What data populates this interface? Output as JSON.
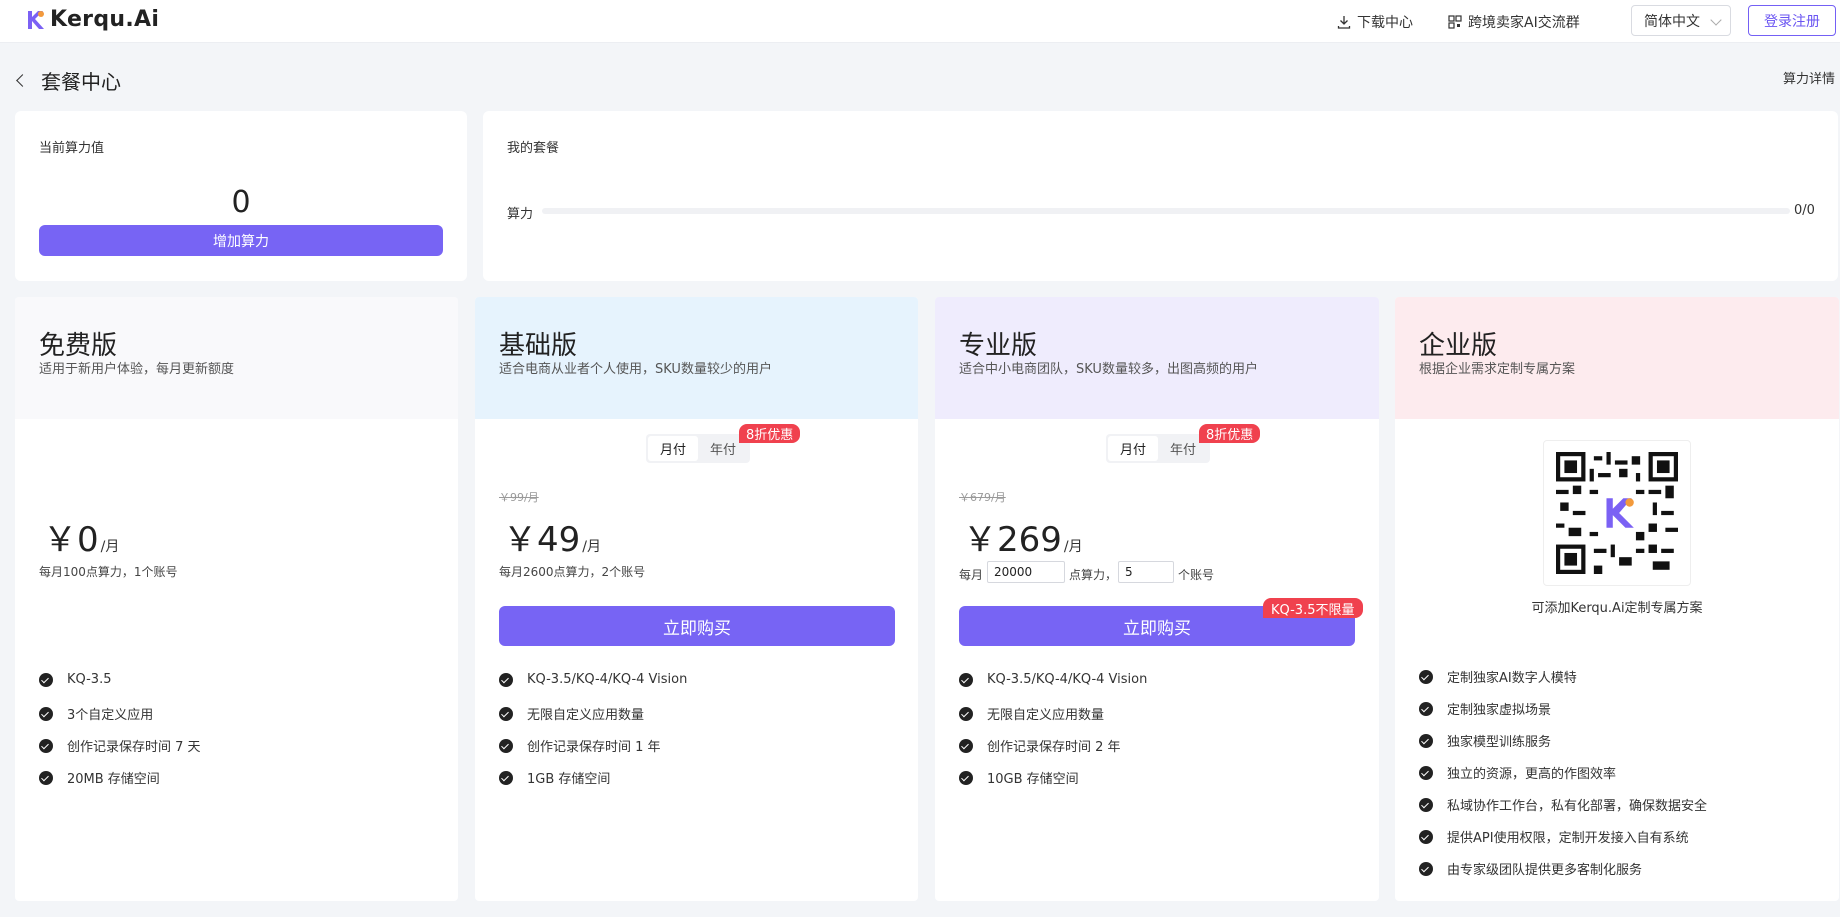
{
  "header": {
    "logo_text": "Kerqu.Ai",
    "download_label": "下载中心",
    "group_label": "跨境卖家AI交流群",
    "language": "简体中文",
    "login_label": "登录注册"
  },
  "page": {
    "title": "套餐中心",
    "detail_link": "算力详情"
  },
  "power_card": {
    "label": "当前算力值",
    "value": "0",
    "add_button": "增加算力"
  },
  "my_plan_card": {
    "label": "我的套餐",
    "progress_label": "算力",
    "progress_value": "0/0",
    "progress_fraction": 0
  },
  "plans": {
    "free": {
      "name": "免费版",
      "desc": "适用于新用户体验，每月更新额度",
      "currency": "￥",
      "price": "0",
      "unit": "/月",
      "quota": "每月100点算力，1个账号",
      "features": [
        "KQ-3.5",
        "3个自定义应用",
        "创作记录保存时间 7 天",
        "20MB 存储空间"
      ]
    },
    "basic": {
      "name": "基础版",
      "desc": "适合电商从业者个人使用，SKU数量较少的用户",
      "toggle_monthly": "月付",
      "toggle_yearly": "年付",
      "discount": "8折优惠",
      "orig_price": "￥99/月",
      "currency": "￥",
      "price": "49",
      "unit": "/月",
      "quota": "每月2600点算力，2个账号",
      "buy_button": "立即购买",
      "features": [
        "KQ-3.5/KQ-4/KQ-4 Vision",
        "无限自定义应用数量",
        "创作记录保存时间 1 年",
        "1GB 存储空间"
      ]
    },
    "pro": {
      "name": "专业版",
      "desc": "适合中小电商团队，SKU数量较多，出图高频的用户",
      "toggle_monthly": "月付",
      "toggle_yearly": "年付",
      "discount": "8折优惠",
      "orig_price": "￥679/月",
      "currency": "￥",
      "price": "269",
      "unit": "/月",
      "quota_prefix": "每月",
      "quota_points": "20000",
      "quota_mid": "点算力，",
      "quota_accounts": "5",
      "quota_suffix": "个账号",
      "buy_button": "立即购买",
      "unlimited_badge": "KQ-3.5不限量",
      "features": [
        "KQ-3.5/KQ-4/KQ-4 Vision",
        "无限自定义应用数量",
        "创作记录保存时间 2 年",
        "10GB 存储空间"
      ]
    },
    "enterprise": {
      "name": "企业版",
      "desc": "根据企业需求定制专属方案",
      "qr_caption": "可添加Kerqu.Ai定制专属方案",
      "features": [
        "定制独家AI数字人模特",
        "定制独家虚拟场景",
        "独家模型训练服务",
        "独立的资源，更高的作图效率",
        "私域协作工作台，私有化部署，确保数据安全",
        "提供API使用权限，定制开发接入自有系统",
        "由专家级团队提供更多客制化服务"
      ]
    }
  },
  "colors": {
    "accent": "#7764f4",
    "badge_red": "#f0414e",
    "free_head": "#f9f9fb",
    "basic_head": "#e6f3fd",
    "pro_head": "#efecfd",
    "enterprise_head": "#fdebee"
  }
}
